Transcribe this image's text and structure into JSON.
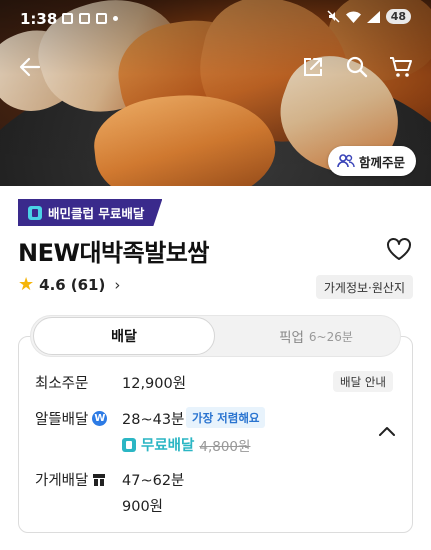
{
  "status_bar": {
    "time": "1:38",
    "battery": "48"
  },
  "header": {
    "together_order_label": "함께주문"
  },
  "club": {
    "badge_label": "배민클럽 무료배달"
  },
  "store": {
    "name": "NEW대박족발보쌈",
    "rating": "4.6",
    "review_count": "(61)",
    "info_button": "가게정보·원산지"
  },
  "tabs": {
    "delivery": "배달",
    "pickup": "픽업",
    "pickup_time": "6~26분"
  },
  "order_info": {
    "min_order_label": "최소주문",
    "min_order_value": "12,900원",
    "delivery_guide": "배달 안내",
    "saver_label": "알뜰배달",
    "saver_time": "28~43분",
    "cheapest_tag": "가장 저렴해요",
    "free_delivery": "무료배달",
    "original_fee": "4,800원",
    "store_delivery_label": "가게배달",
    "store_delivery_time": "47~62분",
    "store_delivery_fee": "900원"
  },
  "icons": [
    "back-arrow-icon",
    "share-icon",
    "search-icon",
    "cart-icon",
    "heart-icon",
    "star-icon",
    "chevron-right-icon",
    "chevron-up-icon"
  ],
  "colors": {
    "club_badge_bg": "#3a2a8c",
    "free_delivery": "#2bb6c4",
    "star": "#f5b50a",
    "cheap_tag_text": "#2a74d0"
  }
}
